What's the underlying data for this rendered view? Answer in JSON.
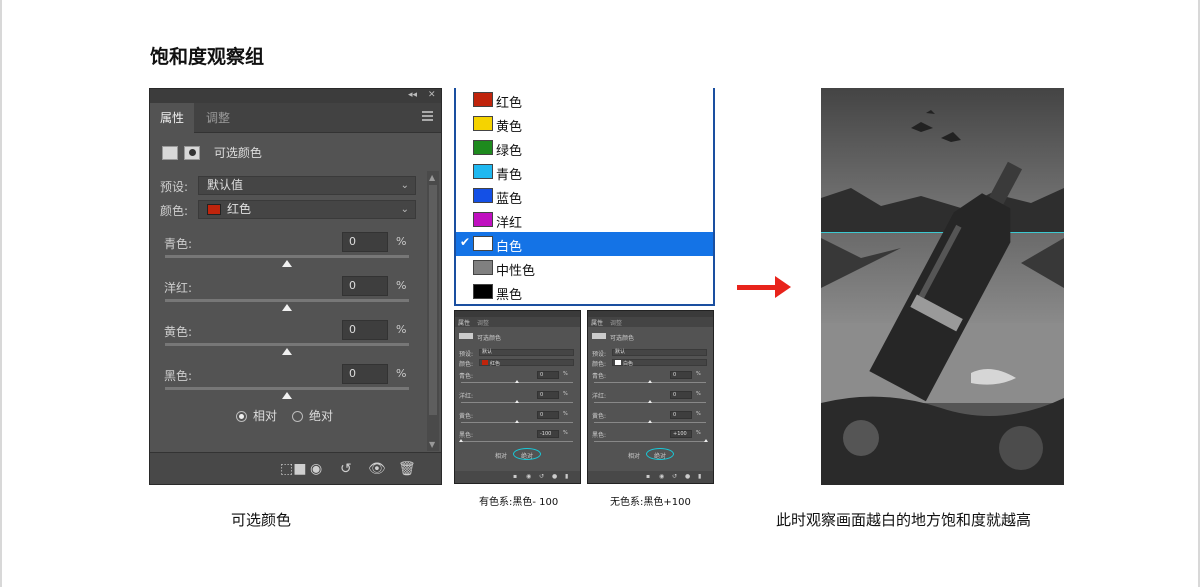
{
  "title": "饱和度观察组",
  "captions": {
    "left": "可选颜色",
    "right": "此时观察画面越白的地方饱和度就越高",
    "mini_left": "有色系:黑色- 100",
    "mini_right": "无色系:黑色+100"
  },
  "panel": {
    "topbar_collapse": "◂◂",
    "topbar_close": "✕",
    "tabs": [
      "属性",
      "调整"
    ],
    "layer_name": "可选颜色",
    "preset_label": "预设:",
    "preset_value": "默认值",
    "colors_label": "颜色:",
    "colors_value": "红色",
    "colors_swatch": "#c0240c",
    "sliders": [
      {
        "label": "青色:",
        "value": "0",
        "unit": "%",
        "position": 0.5
      },
      {
        "label": "洋红:",
        "value": "0",
        "unit": "%",
        "position": 0.5
      },
      {
        "label": "黄色:",
        "value": "0",
        "unit": "%",
        "position": 0.5
      },
      {
        "label": "黑色:",
        "value": "0",
        "unit": "%",
        "position": 0.5
      }
    ],
    "radio_relative": "相对",
    "radio_absolute": "绝对",
    "selected_method": "相对"
  },
  "dropdown": {
    "items": [
      {
        "label": "红色",
        "color": "#c0240c"
      },
      {
        "label": "黄色",
        "color": "#f5d300"
      },
      {
        "label": "绿色",
        "color": "#1e8a1e"
      },
      {
        "label": "青色",
        "color": "#1fb8f0"
      },
      {
        "label": "蓝色",
        "color": "#1450e6"
      },
      {
        "label": "洋红",
        "color": "#c010c0"
      },
      {
        "label": "白色",
        "color": "#ffffff"
      },
      {
        "label": "中性色",
        "color": "#808080"
      },
      {
        "label": "黑色",
        "color": "#000000"
      }
    ],
    "selected": "白色"
  },
  "mini_left": {
    "tabs": [
      "属性",
      "调整"
    ],
    "layer_name": "可选颜色",
    "preset_label": "预设:",
    "preset_value": "默认",
    "colors_label": "颜色:",
    "colors_value": "红色",
    "colors_swatch": "#c0240c",
    "sliders": [
      {
        "label": "青色:",
        "value": "0",
        "position": 0.5
      },
      {
        "label": "洋红:",
        "value": "0",
        "position": 0.5
      },
      {
        "label": "黄色:",
        "value": "0",
        "position": 0.5
      },
      {
        "label": "黑色:",
        "value": "-100",
        "position": 0.0
      }
    ],
    "radio_relative": "相对",
    "radio_absolute": "绝对"
  },
  "mini_right": {
    "tabs": [
      "属性",
      "调整"
    ],
    "layer_name": "可选颜色",
    "preset_label": "预设:",
    "preset_value": "默认",
    "colors_label": "颜色:",
    "colors_value": "白色",
    "colors_swatch": "#ffffff",
    "sliders": [
      {
        "label": "青色:",
        "value": "0",
        "position": 0.5
      },
      {
        "label": "洋红:",
        "value": "0",
        "position": 0.5
      },
      {
        "label": "黄色:",
        "value": "0",
        "position": 0.5
      },
      {
        "label": "黑色:",
        "value": "+100",
        "position": 1.0
      }
    ],
    "radio_relative": "相对",
    "radio_absolute": "绝对"
  },
  "colors": {
    "arrow": "#e8231b",
    "highlight": "#1473e6",
    "ring": "#18c8d8"
  }
}
